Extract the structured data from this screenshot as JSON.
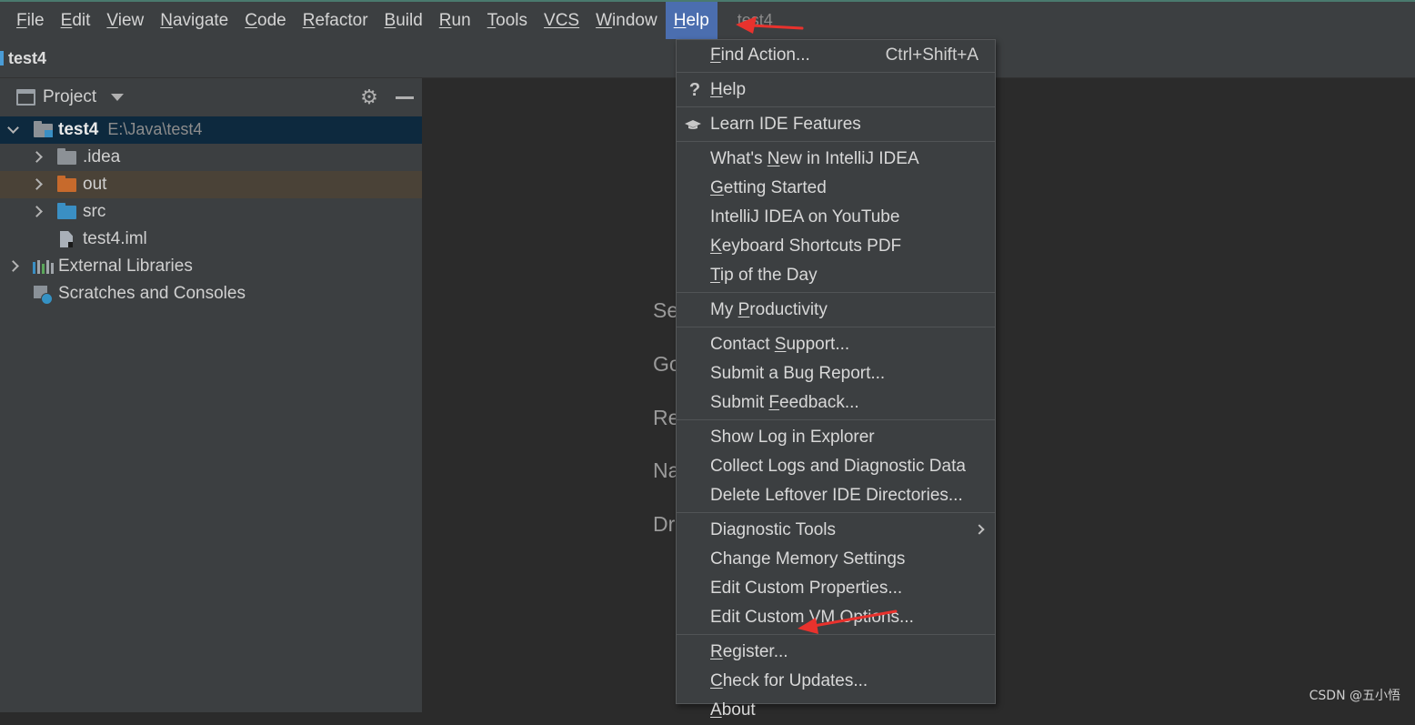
{
  "menubar": {
    "items": [
      {
        "label": "File",
        "mnemonic": "F",
        "rest": "ile"
      },
      {
        "label": "Edit",
        "mnemonic": "E",
        "rest": "dit"
      },
      {
        "label": "View",
        "mnemonic": "V",
        "rest": "iew"
      },
      {
        "label": "Navigate",
        "mnemonic": "N",
        "rest": "avigate"
      },
      {
        "label": "Code",
        "mnemonic": "C",
        "rest": "ode"
      },
      {
        "label": "Refactor",
        "mnemonic": "R",
        "rest": "efactor"
      },
      {
        "label": "Build",
        "mnemonic": "B",
        "rest": "uild"
      },
      {
        "label": "Run",
        "mnemonic": "R",
        "rest": "un"
      },
      {
        "label": "Tools",
        "mnemonic": "T",
        "rest": "ools"
      },
      {
        "label": "VCS",
        "mnemonic": "",
        "rest": "VCS"
      },
      {
        "label": "Window",
        "mnemonic": "W",
        "rest": "indow"
      },
      {
        "label": "Help",
        "mnemonic": "H",
        "rest": "elp"
      }
    ],
    "window_title": "test4"
  },
  "navbar": {
    "project": "test4"
  },
  "project_panel": {
    "title": "Project",
    "tree": {
      "root": {
        "name": "test4",
        "path": "E:\\Java\\test4"
      },
      "idea": ".idea",
      "out": "out",
      "src": "src",
      "iml": "test4.iml",
      "external_libraries": "External Libraries",
      "scratches": "Scratches and Consoles"
    }
  },
  "editor": {
    "hints": [
      "Se",
      "Go",
      "Re",
      "Na",
      "Dr"
    ]
  },
  "help_menu": {
    "find_action": {
      "pre": "",
      "mn": "F",
      "post": "ind Action...",
      "shortcut": "Ctrl+Shift+A"
    },
    "help": {
      "pre": "",
      "mn": "H",
      "post": "elp"
    },
    "learn": {
      "pre": "Learn IDE Features",
      "mn": "",
      "post": ""
    },
    "whats_new": {
      "pre": "What's ",
      "mn": "N",
      "post": "ew in IntelliJ IDEA"
    },
    "getting_started": {
      "pre": "",
      "mn": "G",
      "post": "etting Started"
    },
    "youtube": {
      "pre": "IntelliJ IDEA on YouTube",
      "mn": "",
      "post": ""
    },
    "shortcuts_pdf": {
      "pre": "",
      "mn": "K",
      "post": "eyboard Shortcuts PDF"
    },
    "tip": {
      "pre": "",
      "mn": "T",
      "post": "ip of the Day"
    },
    "productivity": {
      "pre": "My ",
      "mn": "P",
      "post": "roductivity"
    },
    "contact": {
      "pre": "Contact ",
      "mn": "S",
      "post": "upport..."
    },
    "bug": {
      "pre": "Submit a Bug Report...",
      "mn": "",
      "post": ""
    },
    "feedback": {
      "pre": "Submit ",
      "mn": "F",
      "post": "eedback..."
    },
    "show_log": {
      "pre": "Show Log in Explorer",
      "mn": "",
      "post": ""
    },
    "collect_logs": {
      "pre": "Collect Logs and Diagnostic Data",
      "mn": "",
      "post": ""
    },
    "delete_dirs": {
      "pre": "Delete Leftover IDE Directories...",
      "mn": "",
      "post": ""
    },
    "diagnostic": {
      "pre": "Diagnostic Tools",
      "mn": "",
      "post": ""
    },
    "memory": {
      "pre": "Change Memory Settings",
      "mn": "",
      "post": ""
    },
    "properties": {
      "pre": "Edit Custom Properties...",
      "mn": "",
      "post": ""
    },
    "vm_options": {
      "pre": "Edit Custom VM Options...",
      "mn": "",
      "post": ""
    },
    "register": {
      "pre": "",
      "mn": "R",
      "post": "egister..."
    },
    "updates": {
      "pre": "",
      "mn": "C",
      "post": "heck for Updates..."
    },
    "about": {
      "pre": "",
      "mn": "A",
      "post": "bout"
    }
  },
  "watermark": "CSDN @五小悟",
  "colors": {
    "accent_blue": "#4b6eaf",
    "annotation_red": "#e8322d",
    "folder_gray": "#8c9196",
    "folder_orange": "#c76a2c",
    "folder_blue": "#3a8fc4"
  }
}
